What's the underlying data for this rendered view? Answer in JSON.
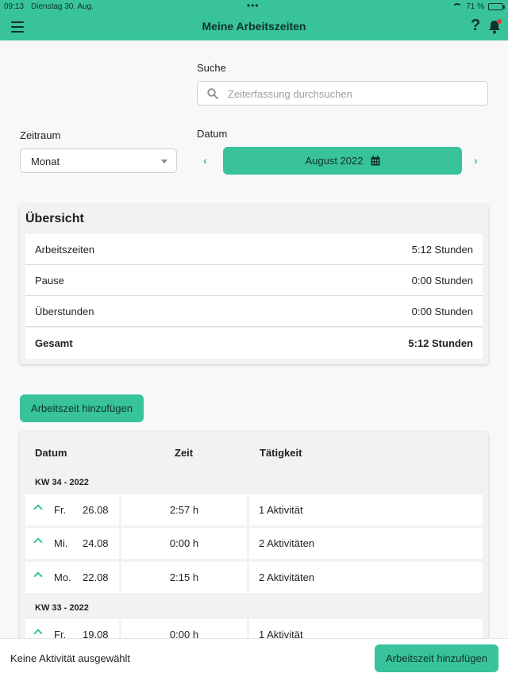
{
  "status_bar": {
    "time": "09:13",
    "date": "Dienstag 30. Aug.",
    "battery": "71 %",
    "battery_level": 0.71
  },
  "header": {
    "title": "Meine Arbeitszeiten",
    "help_label": "?"
  },
  "search": {
    "label": "Suche",
    "placeholder": "Zeiterfassung durchsuchen"
  },
  "period": {
    "label": "Zeitraum",
    "selected": "Monat"
  },
  "date": {
    "label": "Datum",
    "value": "August 2022",
    "prev": "‹",
    "next": "›"
  },
  "overview": {
    "title": "Übersicht",
    "rows": [
      {
        "label": "Arbeitszeiten",
        "value": "5:12 Stunden"
      },
      {
        "label": "Pause",
        "value": "0:00 Stunden"
      },
      {
        "label": "Überstunden",
        "value": "0:00 Stunden"
      },
      {
        "label": "Gesamt",
        "value": "5:12 Stunden"
      }
    ]
  },
  "add_button_label": "Arbeitszeit hinzufügen",
  "table": {
    "headers": {
      "date": "Datum",
      "time": "Zeit",
      "activity": "Tätigkeit"
    },
    "weeks": [
      {
        "label": "KW 34 - 2022",
        "rows": [
          {
            "weekday": "Fr.",
            "date": "26.08",
            "time": "2:57 h",
            "activity": "1 Aktivität"
          },
          {
            "weekday": "Mi.",
            "date": "24.08",
            "time": "0:00 h",
            "activity": "2 Aktivitäten"
          },
          {
            "weekday": "Mo.",
            "date": "22.08",
            "time": "2:15 h",
            "activity": "2 Aktivitäten"
          }
        ]
      },
      {
        "label": "KW 33 - 2022",
        "rows": [
          {
            "weekday": "Fr.",
            "date": "19.08",
            "time": "0:00 h",
            "activity": "1 Aktivität"
          }
        ]
      }
    ]
  },
  "footer": {
    "message": "Keine Aktivität ausgewählt",
    "button_label": "Arbeitszeit hinzufügen"
  }
}
